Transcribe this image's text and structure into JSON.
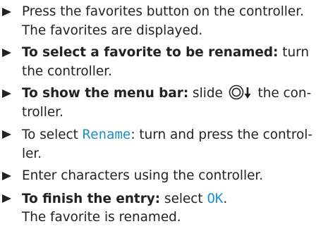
{
  "steps": [
    {
      "text": "Press the favorites button on the controller.",
      "result": "The favorites are displayed."
    },
    {
      "label": "To select a favorite to be renamed:",
      "text": " turn the controller."
    },
    {
      "label": "To show the menu bar:",
      "text_before": " slide",
      "icon": "controller-slide-down-icon",
      "text_after": " the con-troller."
    },
    {
      "text_before": "To select ",
      "ui_term": "Rename",
      "text_after": ": turn and press the control-ler."
    },
    {
      "text": "Enter characters using the controller."
    },
    {
      "label": "To finish the entry:",
      "text_before": " select ",
      "ui_term": "OK",
      "text_after": ".",
      "result": "The favorite is renamed."
    }
  ],
  "colors": {
    "text": "#222222",
    "ui_term": "#1b8fc9"
  }
}
